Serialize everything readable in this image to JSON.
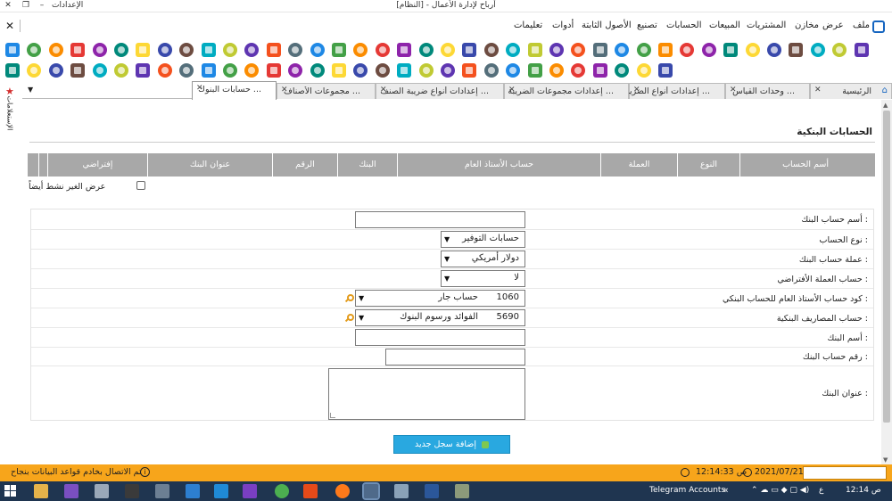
{
  "window": {
    "title": "أرباح لإدارة الأعمال - [النظام]",
    "left_label": "الإعدادات"
  },
  "menu": [
    "ملف",
    "عرض",
    "مخازن",
    "المشتريات",
    "المبيعات",
    "الحسابات",
    "تصنيع",
    "الأصول الثابتة",
    "أدوات",
    "تعليمات"
  ],
  "side_label": "الإستعلامات",
  "tabs": [
    {
      "label": "الرئيسية",
      "active": false
    },
    {
      "label": "وحدات القياس ...",
      "active": false
    },
    {
      "label": "إعدادات أنواع الضريبة ...",
      "active": false
    },
    {
      "label": "إعدادات مجموعات الضريبة ...",
      "active": false
    },
    {
      "label": "إعدادات أنواع ضريبة الصنف ...",
      "active": false
    },
    {
      "label": "مجموعات الأصناف ...",
      "active": false
    },
    {
      "label": "حسابات البنوك ...",
      "active": true
    }
  ],
  "page_title": "الحسابات البنكية",
  "grid": {
    "columns": [
      "أسم الحساب",
      "النوع",
      "العملة",
      "حساب الأستاذ العام",
      "البنك",
      "الرقم",
      "عنوان البنك",
      "إفتراضي"
    ]
  },
  "show_inactive_label": "عرض الغير نشط أيضاً",
  "form": {
    "account_name_label": "أسم حساب البنك :",
    "account_name_value": "",
    "account_type_label": "نوع الحساب :",
    "account_type_value": "حسابات التوفير",
    "currency_label": "عملة حساب البنك :",
    "currency_value": "دولار أمريكي",
    "default_currency_label": "حساب العملة الأفتراضي :",
    "default_currency_value": "لا",
    "gl_code_label": "كود حساب الأستاذ العام للحساب البنكي :",
    "gl_code": "1060",
    "gl_name": "حساب جار",
    "charges_label": "حساب المصاريف البنكية :",
    "charges_code": "5690",
    "charges_name": "الفوائد ورسوم البنوك",
    "bank_name_label": "أسم البنك :",
    "bank_name_value": "",
    "account_number_label": "رقم حساب البنك :",
    "account_number_value": "",
    "bank_address_label": "عنوان البنك :",
    "bank_address_value": ""
  },
  "add_button_label": "إضافة سجل جديد",
  "status": {
    "message": "تم الاتصال بخادم قواعد البيانات بنجاح",
    "date": "2021/07/21",
    "time": "12:14:33 ص"
  },
  "taskbar": {
    "telegram": "Telegram Accounts",
    "chevron": "«",
    "lang": "ع",
    "clock": "12:14 ص"
  },
  "colors": {
    "status_bar": "#f7a51b",
    "grid_header": "#a8a8a8",
    "add_button": "#29a8e0",
    "taskbar": "#1f3550"
  }
}
